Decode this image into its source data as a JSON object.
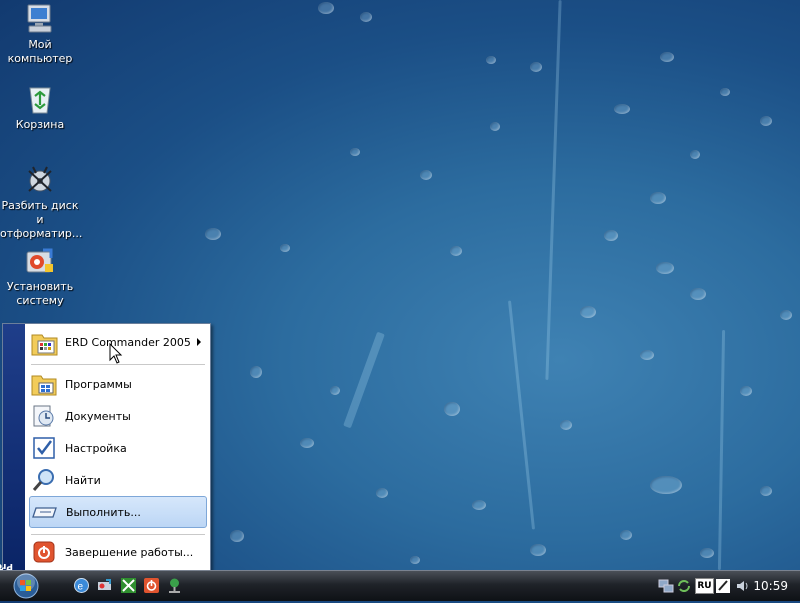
{
  "desktop": {
    "icons": [
      {
        "label": "Мой компьютер",
        "icon": "my-computer-icon"
      },
      {
        "label": "Корзина",
        "icon": "recycle-bin-icon"
      },
      {
        "label": "Разбить диск и отформатир...",
        "icon": "partition-disk-icon"
      },
      {
        "label": "Установить систему",
        "icon": "install-system-icon"
      }
    ]
  },
  "start_menu": {
    "side_stripe": {
      "brand": "Windows",
      "subtitle": "Preinstallation Environment"
    },
    "items": [
      {
        "label": "ERD Commander 2005",
        "icon": "erd-commander-icon",
        "has_submenu": true
      },
      {
        "label": "Программы",
        "icon": "programs-folder-icon"
      },
      {
        "label": "Документы",
        "icon": "documents-icon"
      },
      {
        "label": "Настройка",
        "icon": "settings-icon"
      },
      {
        "label": "Найти",
        "icon": "search-icon"
      },
      {
        "label": "Выполнить...",
        "icon": "run-icon",
        "highlighted": true
      },
      {
        "label": "Завершение работы...",
        "icon": "shutdown-icon"
      }
    ]
  },
  "taskbar": {
    "start_button": "windows-orb-icon",
    "quick_launch": [
      "browser-icon",
      "network-tool-icon",
      "grid-tool-icon",
      "power-tool-icon",
      "network-share-icon"
    ],
    "tray": {
      "icons": [
        "network-status-icon",
        "sync-icon",
        "pen-tool-icon",
        "volume-icon"
      ],
      "language": "RU",
      "clock": "10:59"
    }
  },
  "colors": {
    "accent": "#0a2466",
    "highlight": "#bcd6f5",
    "desktop": "#1b4f86"
  }
}
